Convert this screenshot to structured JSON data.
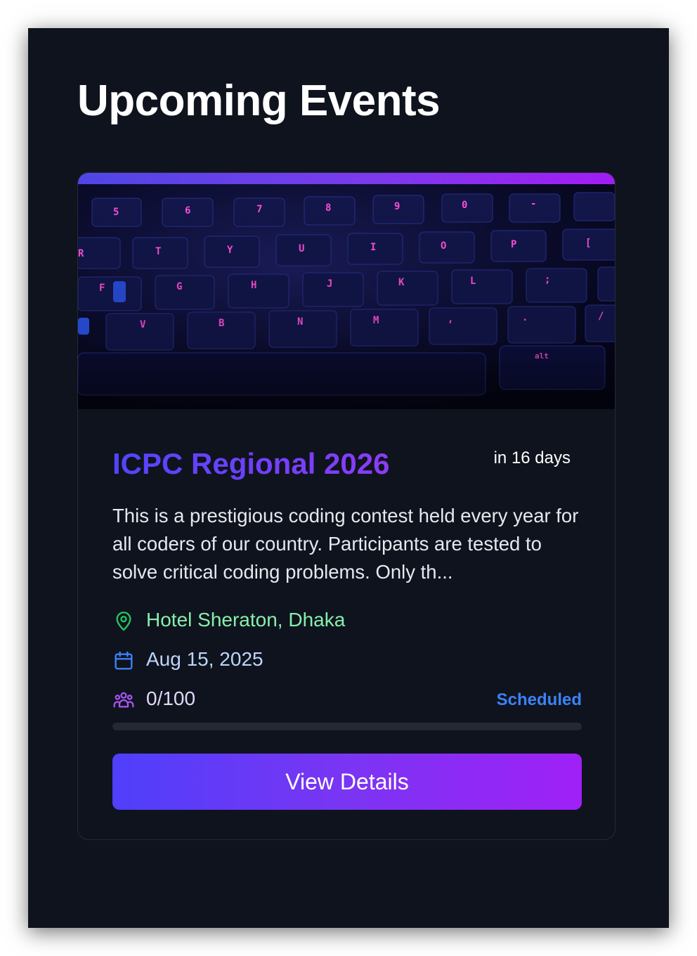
{
  "page": {
    "heading": "Upcoming Events"
  },
  "event": {
    "image_alt": "keyboard-photo",
    "title": "ICPC Regional 2026",
    "countdown": "in 16 days",
    "description": "This is a prestigious coding contest held every year for all coders of our country. Participants are tested to solve critical coding problems. Only th...",
    "location": "Hotel Sheraton, Dhaka",
    "date": "Aug 15, 2025",
    "capacity": "0/100",
    "registered_fraction": 0,
    "status": "Scheduled",
    "cta_label": "View Details"
  },
  "icons": {
    "location": "map-pin-icon",
    "date": "calendar-icon",
    "capacity": "users-icon"
  },
  "colors": {
    "accent_start": "#4f46e5",
    "accent_end": "#a21cf3",
    "location_text": "#86efac",
    "date_text": "#bcd6fb",
    "status": "#3b82f6",
    "background": "#0f131d"
  }
}
